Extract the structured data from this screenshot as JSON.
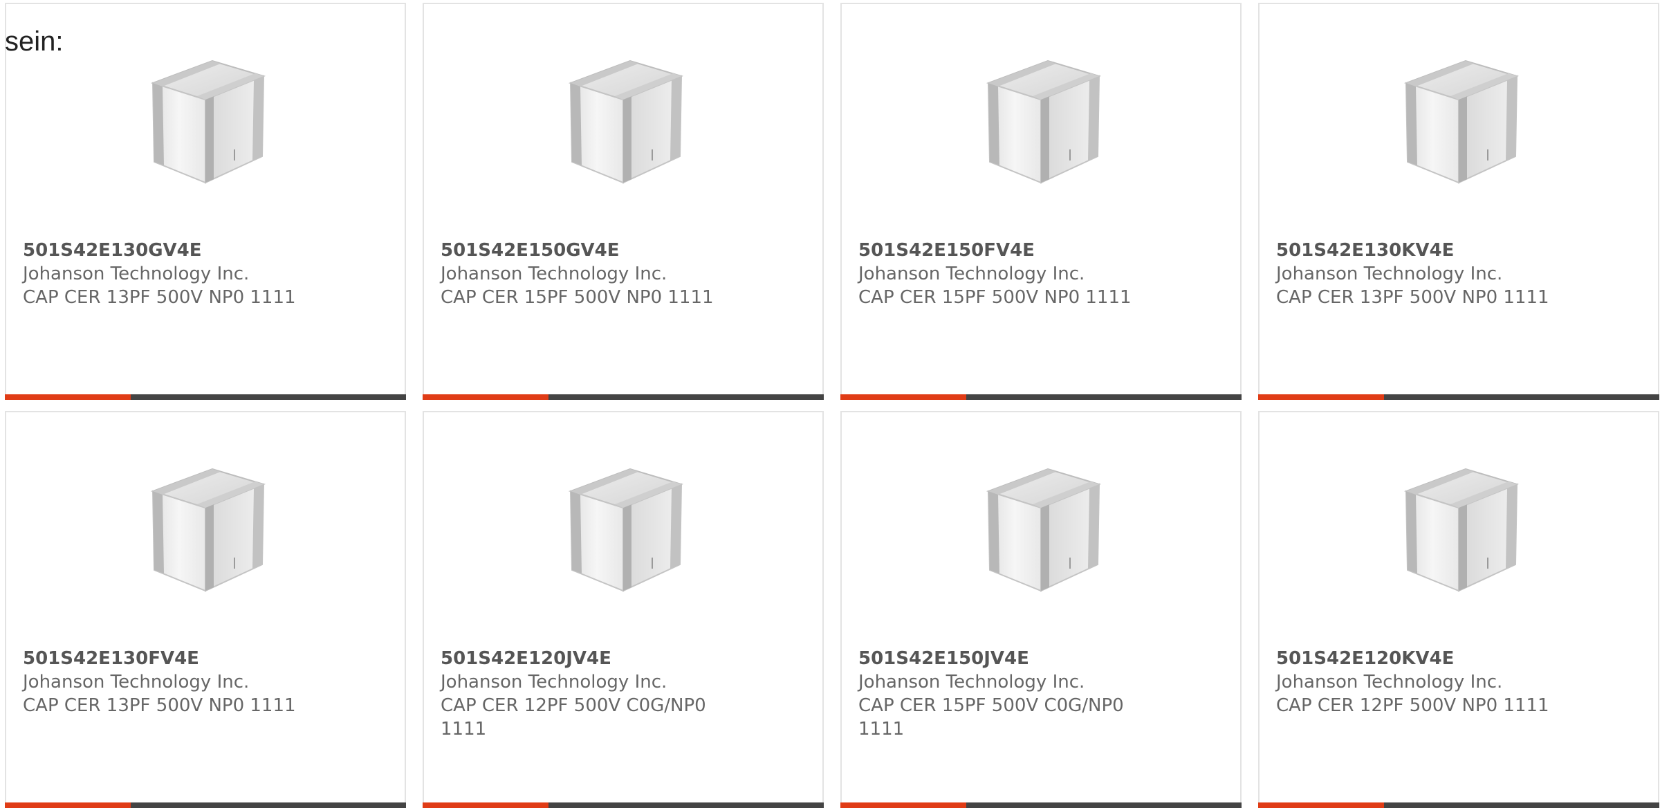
{
  "intro_text": "sein:",
  "colors": {
    "accent": "#e03c16",
    "bar": "#444444",
    "border": "#e3e3e3",
    "text": "#666666"
  },
  "products": [
    {
      "part_number": "501S42E130GV4E",
      "manufacturer": "Johanson Technology Inc.",
      "description": "CAP CER 13PF 500V NP0 1111",
      "image": "ceramic-capacitor-cube-image"
    },
    {
      "part_number": "501S42E150GV4E",
      "manufacturer": "Johanson Technology Inc.",
      "description": "CAP CER 15PF 500V NP0 1111",
      "image": "ceramic-capacitor-cube-image"
    },
    {
      "part_number": "501S42E150FV4E",
      "manufacturer": "Johanson Technology Inc.",
      "description": "CAP CER 15PF 500V NP0 1111",
      "image": "ceramic-capacitor-cube-image"
    },
    {
      "part_number": "501S42E130KV4E",
      "manufacturer": "Johanson Technology Inc.",
      "description": "CAP CER 13PF 500V NP0 1111",
      "image": "ceramic-capacitor-cube-image"
    },
    {
      "part_number": "501S42E130FV4E",
      "manufacturer": "Johanson Technology Inc.",
      "description": "CAP CER 13PF 500V NP0 1111",
      "image": "ceramic-capacitor-cube-image"
    },
    {
      "part_number": "501S42E120JV4E",
      "manufacturer": "Johanson Technology Inc.",
      "description": "CAP CER 12PF 500V C0G/NP0 1111",
      "image": "ceramic-capacitor-cube-image"
    },
    {
      "part_number": "501S42E150JV4E",
      "manufacturer": "Johanson Technology Inc.",
      "description": "CAP CER 15PF 500V C0G/NP0 1111",
      "image": "ceramic-capacitor-cube-image"
    },
    {
      "part_number": "501S42E120KV4E",
      "manufacturer": "Johanson Technology Inc.",
      "description": "CAP CER 12PF 500V NP0 1111",
      "image": "ceramic-capacitor-cube-image"
    }
  ]
}
